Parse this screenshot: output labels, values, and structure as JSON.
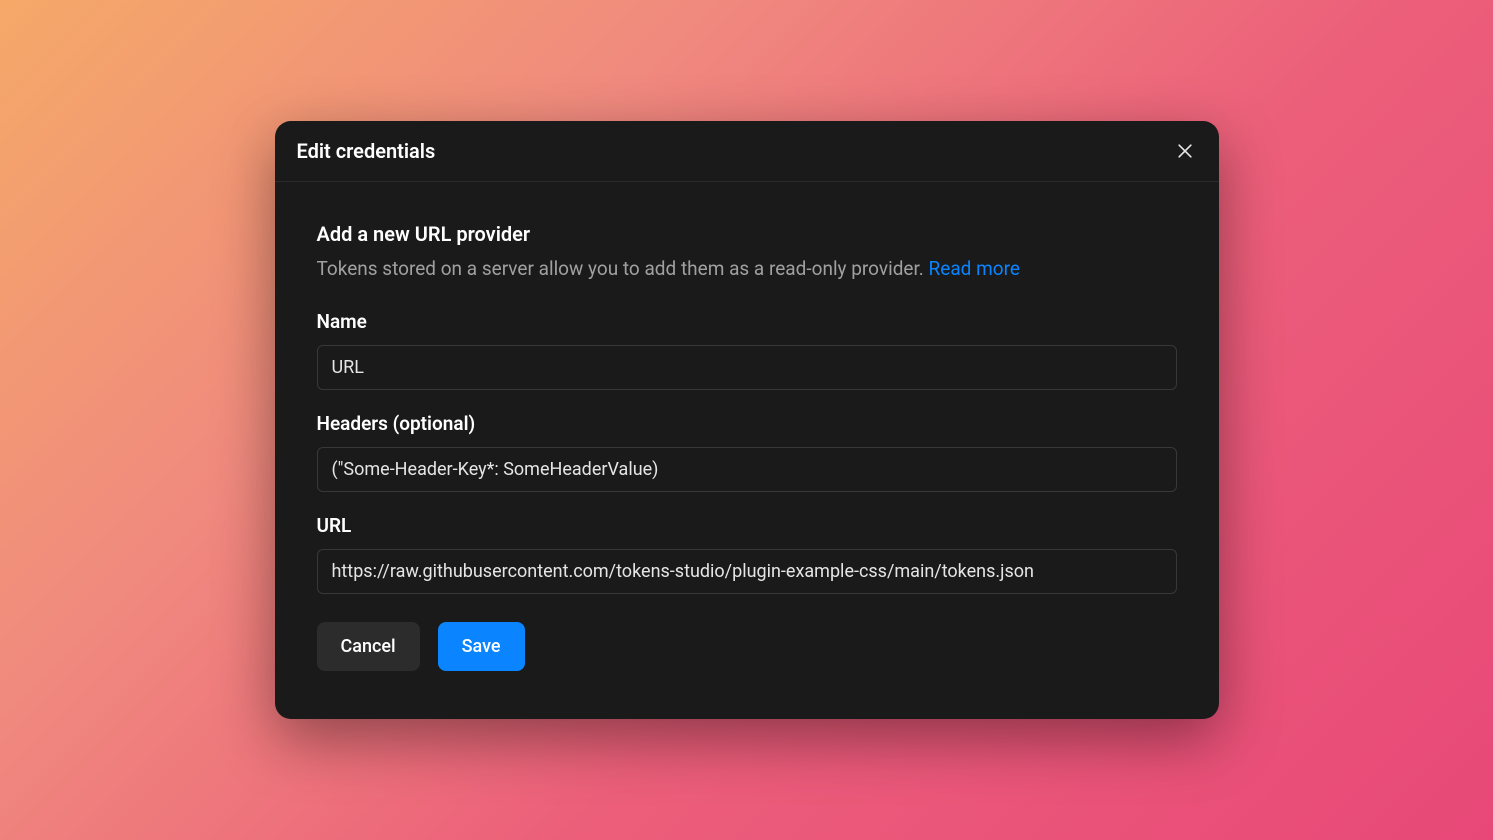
{
  "modal": {
    "title": "Edit credentials",
    "section_title": "Add a new URL provider",
    "description": "Tokens stored on a server allow you to add them as a read-only provider. ",
    "read_more": "Read more",
    "fields": {
      "name": {
        "label": "Name",
        "value": "URL"
      },
      "headers": {
        "label": "Headers (optional)",
        "value": "(\"Some-Header-Key*: SomeHeaderValue)"
      },
      "url": {
        "label": "URL",
        "value": "https://raw.githubusercontent.com/tokens-studio/plugin-example-css/main/tokens.json"
      }
    },
    "buttons": {
      "cancel": "Cancel",
      "save": "Save"
    }
  },
  "colors": {
    "background_gradient_start": "#f5a968",
    "background_gradient_end": "#e84878",
    "modal_bg": "#1a1a1a",
    "accent": "#0a84ff"
  }
}
